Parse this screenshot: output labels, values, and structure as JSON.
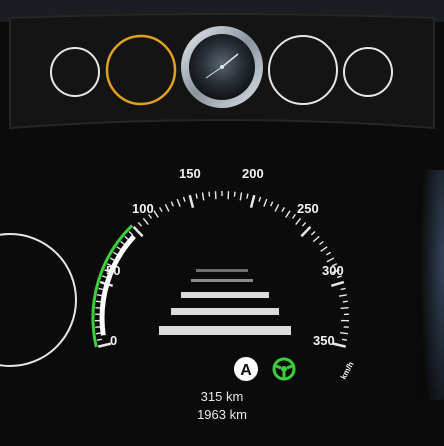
{
  "top_dials": {
    "outline_color": "#e6e6e6",
    "highlight_color": "#e0a020"
  },
  "speedometer": {
    "unit": "km/h",
    "labels": [
      "0",
      "50",
      "100",
      "150",
      "200",
      "250",
      "300",
      "350"
    ],
    "active_arc_color": "#3ccf3c"
  },
  "assist": {
    "letter_badge": "A",
    "steering_icon_color": "#3ccf3c"
  },
  "odometer": {
    "trip": "315 km",
    "total": "1963 km"
  }
}
